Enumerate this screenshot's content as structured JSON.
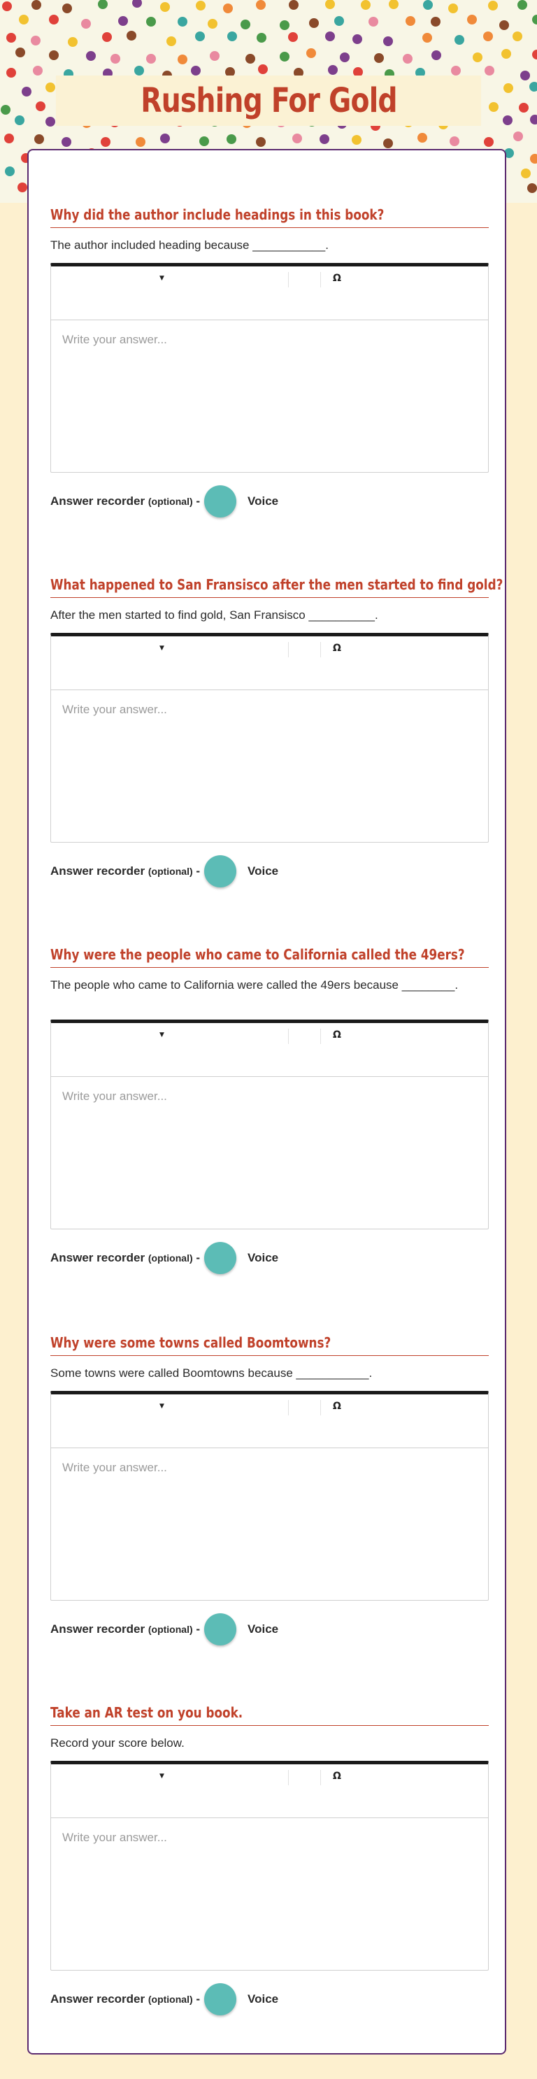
{
  "page": {
    "title": "Rushing For Gold"
  },
  "editor": {
    "dropdown_icon": "caret-down-icon",
    "special_char_icon": "omega-icon",
    "omega_glyph": "Ω",
    "caret_glyph": "▼",
    "placeholder": "Write your answer..."
  },
  "recorder": {
    "label": "Answer recorder",
    "optional": "(optional)",
    "dash": "-",
    "voice": "Voice"
  },
  "questions": [
    {
      "title": "Why did the author include headings in this book?",
      "prompt": "The author included heading because ___________."
    },
    {
      "title": "What happened to San Fransisco after the men started to find gold?",
      "prompt": "After the men started to find gold, San Fransisco __________."
    },
    {
      "title": "Why were the people who came to California called the 49ers?",
      "prompt": "The people who came to California were called the 49ers because ________."
    },
    {
      "title": "Why were some towns called Boomtowns?",
      "prompt": "Some towns were called Boomtowns because ___________."
    },
    {
      "title": "Take an AR test on you book.",
      "prompt": "Record your score below."
    }
  ],
  "colors": {
    "accent": "#c0412a",
    "card_border": "#5b2a6f",
    "record_button": "#5cbcb6",
    "background": "#fdf0cf"
  }
}
